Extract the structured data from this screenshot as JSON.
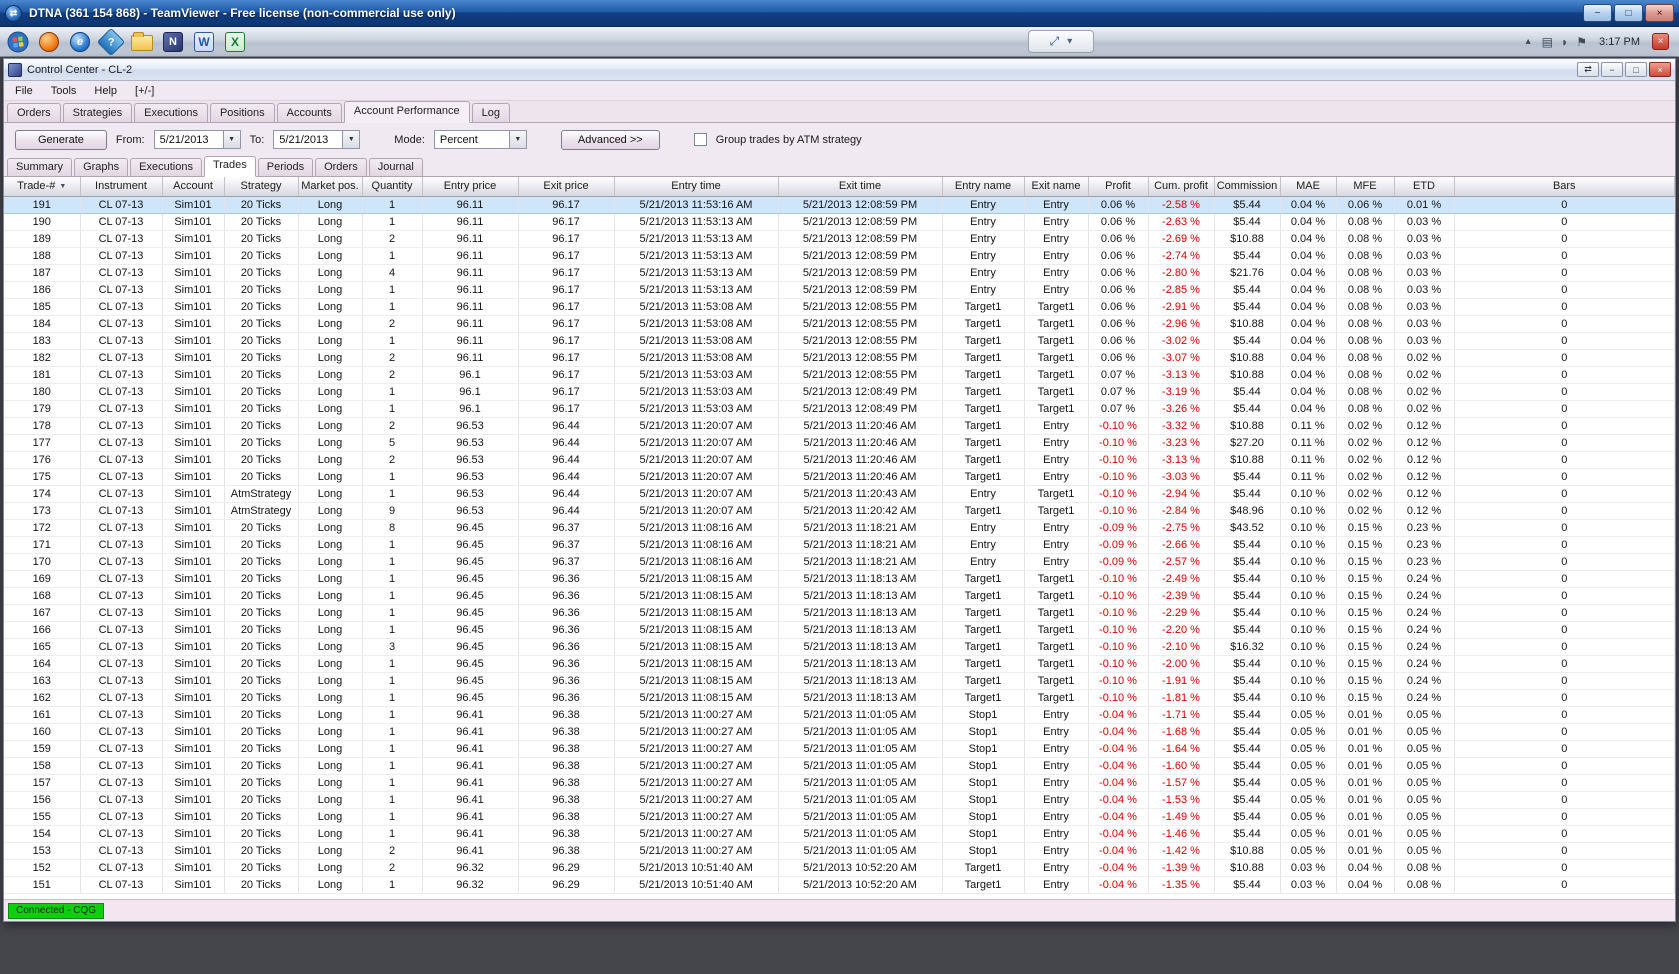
{
  "teamviewer": {
    "title": "DTNA (361 154 868) - TeamViewer - Free license (non-commercial use only)"
  },
  "taskbar": {
    "clock": "3:17 PM"
  },
  "window": {
    "title": "Control Center - CL-2",
    "menus": [
      "File",
      "Tools",
      "Help",
      "[+/-]"
    ]
  },
  "tabs": [
    "Orders",
    "Strategies",
    "Executions",
    "Positions",
    "Accounts",
    "Account Performance",
    "Log"
  ],
  "subtabs": [
    "Summary",
    "Graphs",
    "Executions",
    "Trades",
    "Periods",
    "Orders",
    "Journal"
  ],
  "toolbar": {
    "generate": "Generate",
    "from_label": "From:",
    "from_value": "5/21/2013",
    "to_label": "To:",
    "to_value": "5/21/2013",
    "mode_label": "Mode:",
    "mode_value": "Percent",
    "advanced": "Advanced >>",
    "group_label": "Group trades by ATM strategy",
    "group_checked": false
  },
  "statusbar": {
    "connection": "Connected - CQG"
  },
  "colors": {
    "negative_value": "#d40000",
    "selected_row": "#cfe5fa",
    "status_connected": "#0ecf0e",
    "titlebar_blue": "#215aa6"
  },
  "icons": {
    "minimize": "−",
    "maximize": "□",
    "close": "×",
    "sort_desc": "▼",
    "dropdown_arrow": "▼",
    "chevron_down": "▾",
    "resize": "⤢",
    "hidden_icons": "▴",
    "link": "⇄",
    "help": "?",
    "ie": "e",
    "ninjatrader": "N",
    "word": "W",
    "excel": "X",
    "tray_display": "▤",
    "tray_volume": "◗",
    "tray_flag": "⚑",
    "session_close": "×",
    "tv_logo": "⇄"
  },
  "table": {
    "sort_column": "Trade-#",
    "sort_direction": "desc",
    "selected_row_index": 0,
    "columns": [
      "Trade-#",
      "Instrument",
      "Account",
      "Strategy",
      "Market pos.",
      "Quantity",
      "Entry price",
      "Exit price",
      "Entry time",
      "Exit time",
      "Entry name",
      "Exit name",
      "Profit",
      "Cum. profit",
      "Commission",
      "MAE",
      "MFE",
      "ETD",
      "Bars"
    ],
    "rows": [
      [
        "191",
        "CL 07-13",
        "Sim101",
        "20 Ticks",
        "Long",
        "1",
        "96.11",
        "96.17",
        "5/21/2013 11:53:16 AM",
        "5/21/2013 12:08:59 PM",
        "Entry",
        "Entry",
        "0.06 %",
        "-2.58 %",
        "$5.44",
        "0.04 %",
        "0.06 %",
        "0.01 %",
        "0"
      ],
      [
        "190",
        "CL 07-13",
        "Sim101",
        "20 Ticks",
        "Long",
        "1",
        "96.11",
        "96.17",
        "5/21/2013 11:53:13 AM",
        "5/21/2013 12:08:59 PM",
        "Entry",
        "Entry",
        "0.06 %",
        "-2.63 %",
        "$5.44",
        "0.04 %",
        "0.08 %",
        "0.03 %",
        "0"
      ],
      [
        "189",
        "CL 07-13",
        "Sim101",
        "20 Ticks",
        "Long",
        "2",
        "96.11",
        "96.17",
        "5/21/2013 11:53:13 AM",
        "5/21/2013 12:08:59 PM",
        "Entry",
        "Entry",
        "0.06 %",
        "-2.69 %",
        "$10.88",
        "0.04 %",
        "0.08 %",
        "0.03 %",
        "0"
      ],
      [
        "188",
        "CL 07-13",
        "Sim101",
        "20 Ticks",
        "Long",
        "1",
        "96.11",
        "96.17",
        "5/21/2013 11:53:13 AM",
        "5/21/2013 12:08:59 PM",
        "Entry",
        "Entry",
        "0.06 %",
        "-2.74 %",
        "$5.44",
        "0.04 %",
        "0.08 %",
        "0.03 %",
        "0"
      ],
      [
        "187",
        "CL 07-13",
        "Sim101",
        "20 Ticks",
        "Long",
        "4",
        "96.11",
        "96.17",
        "5/21/2013 11:53:13 AM",
        "5/21/2013 12:08:59 PM",
        "Entry",
        "Entry",
        "0.06 %",
        "-2.80 %",
        "$21.76",
        "0.04 %",
        "0.08 %",
        "0.03 %",
        "0"
      ],
      [
        "186",
        "CL 07-13",
        "Sim101",
        "20 Ticks",
        "Long",
        "1",
        "96.11",
        "96.17",
        "5/21/2013 11:53:13 AM",
        "5/21/2013 12:08:59 PM",
        "Entry",
        "Entry",
        "0.06 %",
        "-2.85 %",
        "$5.44",
        "0.04 %",
        "0.08 %",
        "0.03 %",
        "0"
      ],
      [
        "185",
        "CL 07-13",
        "Sim101",
        "20 Ticks",
        "Long",
        "1",
        "96.11",
        "96.17",
        "5/21/2013 11:53:08 AM",
        "5/21/2013 12:08:55 PM",
        "Target1",
        "Target1",
        "0.06 %",
        "-2.91 %",
        "$5.44",
        "0.04 %",
        "0.08 %",
        "0.03 %",
        "0"
      ],
      [
        "184",
        "CL 07-13",
        "Sim101",
        "20 Ticks",
        "Long",
        "2",
        "96.11",
        "96.17",
        "5/21/2013 11:53:08 AM",
        "5/21/2013 12:08:55 PM",
        "Target1",
        "Target1",
        "0.06 %",
        "-2.96 %",
        "$10.88",
        "0.04 %",
        "0.08 %",
        "0.03 %",
        "0"
      ],
      [
        "183",
        "CL 07-13",
        "Sim101",
        "20 Ticks",
        "Long",
        "1",
        "96.11",
        "96.17",
        "5/21/2013 11:53:08 AM",
        "5/21/2013 12:08:55 PM",
        "Target1",
        "Target1",
        "0.06 %",
        "-3.02 %",
        "$5.44",
        "0.04 %",
        "0.08 %",
        "0.03 %",
        "0"
      ],
      [
        "182",
        "CL 07-13",
        "Sim101",
        "20 Ticks",
        "Long",
        "2",
        "96.11",
        "96.17",
        "5/21/2013 11:53:08 AM",
        "5/21/2013 12:08:55 PM",
        "Target1",
        "Target1",
        "0.06 %",
        "-3.07 %",
        "$10.88",
        "0.04 %",
        "0.08 %",
        "0.02 %",
        "0"
      ],
      [
        "181",
        "CL 07-13",
        "Sim101",
        "20 Ticks",
        "Long",
        "2",
        "96.1",
        "96.17",
        "5/21/2013 11:53:03 AM",
        "5/21/2013 12:08:55 PM",
        "Target1",
        "Target1",
        "0.07 %",
        "-3.13 %",
        "$10.88",
        "0.04 %",
        "0.08 %",
        "0.02 %",
        "0"
      ],
      [
        "180",
        "CL 07-13",
        "Sim101",
        "20 Ticks",
        "Long",
        "1",
        "96.1",
        "96.17",
        "5/21/2013 11:53:03 AM",
        "5/21/2013 12:08:49 PM",
        "Target1",
        "Target1",
        "0.07 %",
        "-3.19 %",
        "$5.44",
        "0.04 %",
        "0.08 %",
        "0.02 %",
        "0"
      ],
      [
        "179",
        "CL 07-13",
        "Sim101",
        "20 Ticks",
        "Long",
        "1",
        "96.1",
        "96.17",
        "5/21/2013 11:53:03 AM",
        "5/21/2013 12:08:49 PM",
        "Target1",
        "Target1",
        "0.07 %",
        "-3.26 %",
        "$5.44",
        "0.04 %",
        "0.08 %",
        "0.02 %",
        "0"
      ],
      [
        "178",
        "CL 07-13",
        "Sim101",
        "20 Ticks",
        "Long",
        "2",
        "96.53",
        "96.44",
        "5/21/2013 11:20:07 AM",
        "5/21/2013 11:20:46 AM",
        "Target1",
        "Entry",
        "-0.10 %",
        "-3.32 %",
        "$10.88",
        "0.11 %",
        "0.02 %",
        "0.12 %",
        "0"
      ],
      [
        "177",
        "CL 07-13",
        "Sim101",
        "20 Ticks",
        "Long",
        "5",
        "96.53",
        "96.44",
        "5/21/2013 11:20:07 AM",
        "5/21/2013 11:20:46 AM",
        "Target1",
        "Entry",
        "-0.10 %",
        "-3.23 %",
        "$27.20",
        "0.11 %",
        "0.02 %",
        "0.12 %",
        "0"
      ],
      [
        "176",
        "CL 07-13",
        "Sim101",
        "20 Ticks",
        "Long",
        "2",
        "96.53",
        "96.44",
        "5/21/2013 11:20:07 AM",
        "5/21/2013 11:20:46 AM",
        "Target1",
        "Entry",
        "-0.10 %",
        "-3.13 %",
        "$10.88",
        "0.11 %",
        "0.02 %",
        "0.12 %",
        "0"
      ],
      [
        "175",
        "CL 07-13",
        "Sim101",
        "20 Ticks",
        "Long",
        "1",
        "96.53",
        "96.44",
        "5/21/2013 11:20:07 AM",
        "5/21/2013 11:20:46 AM",
        "Target1",
        "Entry",
        "-0.10 %",
        "-3.03 %",
        "$5.44",
        "0.11 %",
        "0.02 %",
        "0.12 %",
        "0"
      ],
      [
        "174",
        "CL 07-13",
        "Sim101",
        "AtmStrategy",
        "Long",
        "1",
        "96.53",
        "96.44",
        "5/21/2013 11:20:07 AM",
        "5/21/2013 11:20:43 AM",
        "Entry",
        "Target1",
        "-0.10 %",
        "-2.94 %",
        "$5.44",
        "0.10 %",
        "0.02 %",
        "0.12 %",
        "0"
      ],
      [
        "173",
        "CL 07-13",
        "Sim101",
        "AtmStrategy",
        "Long",
        "9",
        "96.53",
        "96.44",
        "5/21/2013 11:20:07 AM",
        "5/21/2013 11:20:42 AM",
        "Target1",
        "Target1",
        "-0.10 %",
        "-2.84 %",
        "$48.96",
        "0.10 %",
        "0.02 %",
        "0.12 %",
        "0"
      ],
      [
        "172",
        "CL 07-13",
        "Sim101",
        "20 Ticks",
        "Long",
        "8",
        "96.45",
        "96.37",
        "5/21/2013 11:08:16 AM",
        "5/21/2013 11:18:21 AM",
        "Entry",
        "Entry",
        "-0.09 %",
        "-2.75 %",
        "$43.52",
        "0.10 %",
        "0.15 %",
        "0.23 %",
        "0"
      ],
      [
        "171",
        "CL 07-13",
        "Sim101",
        "20 Ticks",
        "Long",
        "1",
        "96.45",
        "96.37",
        "5/21/2013 11:08:16 AM",
        "5/21/2013 11:18:21 AM",
        "Entry",
        "Entry",
        "-0.09 %",
        "-2.66 %",
        "$5.44",
        "0.10 %",
        "0.15 %",
        "0.23 %",
        "0"
      ],
      [
        "170",
        "CL 07-13",
        "Sim101",
        "20 Ticks",
        "Long",
        "1",
        "96.45",
        "96.37",
        "5/21/2013 11:08:16 AM",
        "5/21/2013 11:18:21 AM",
        "Entry",
        "Entry",
        "-0.09 %",
        "-2.57 %",
        "$5.44",
        "0.10 %",
        "0.15 %",
        "0.23 %",
        "0"
      ],
      [
        "169",
        "CL 07-13",
        "Sim101",
        "20 Ticks",
        "Long",
        "1",
        "96.45",
        "96.36",
        "5/21/2013 11:08:15 AM",
        "5/21/2013 11:18:13 AM",
        "Target1",
        "Target1",
        "-0.10 %",
        "-2.49 %",
        "$5.44",
        "0.10 %",
        "0.15 %",
        "0.24 %",
        "0"
      ],
      [
        "168",
        "CL 07-13",
        "Sim101",
        "20 Ticks",
        "Long",
        "1",
        "96.45",
        "96.36",
        "5/21/2013 11:08:15 AM",
        "5/21/2013 11:18:13 AM",
        "Target1",
        "Target1",
        "-0.10 %",
        "-2.39 %",
        "$5.44",
        "0.10 %",
        "0.15 %",
        "0.24 %",
        "0"
      ],
      [
        "167",
        "CL 07-13",
        "Sim101",
        "20 Ticks",
        "Long",
        "1",
        "96.45",
        "96.36",
        "5/21/2013 11:08:15 AM",
        "5/21/2013 11:18:13 AM",
        "Target1",
        "Target1",
        "-0.10 %",
        "-2.29 %",
        "$5.44",
        "0.10 %",
        "0.15 %",
        "0.24 %",
        "0"
      ],
      [
        "166",
        "CL 07-13",
        "Sim101",
        "20 Ticks",
        "Long",
        "1",
        "96.45",
        "96.36",
        "5/21/2013 11:08:15 AM",
        "5/21/2013 11:18:13 AM",
        "Target1",
        "Target1",
        "-0.10 %",
        "-2.20 %",
        "$5.44",
        "0.10 %",
        "0.15 %",
        "0.24 %",
        "0"
      ],
      [
        "165",
        "CL 07-13",
        "Sim101",
        "20 Ticks",
        "Long",
        "3",
        "96.45",
        "96.36",
        "5/21/2013 11:08:15 AM",
        "5/21/2013 11:18:13 AM",
        "Target1",
        "Target1",
        "-0.10 %",
        "-2.10 %",
        "$16.32",
        "0.10 %",
        "0.15 %",
        "0.24 %",
        "0"
      ],
      [
        "164",
        "CL 07-13",
        "Sim101",
        "20 Ticks",
        "Long",
        "1",
        "96.45",
        "96.36",
        "5/21/2013 11:08:15 AM",
        "5/21/2013 11:18:13 AM",
        "Target1",
        "Target1",
        "-0.10 %",
        "-2.00 %",
        "$5.44",
        "0.10 %",
        "0.15 %",
        "0.24 %",
        "0"
      ],
      [
        "163",
        "CL 07-13",
        "Sim101",
        "20 Ticks",
        "Long",
        "1",
        "96.45",
        "96.36",
        "5/21/2013 11:08:15 AM",
        "5/21/2013 11:18:13 AM",
        "Target1",
        "Target1",
        "-0.10 %",
        "-1.91 %",
        "$5.44",
        "0.10 %",
        "0.15 %",
        "0.24 %",
        "0"
      ],
      [
        "162",
        "CL 07-13",
        "Sim101",
        "20 Ticks",
        "Long",
        "1",
        "96.45",
        "96.36",
        "5/21/2013 11:08:15 AM",
        "5/21/2013 11:18:13 AM",
        "Target1",
        "Target1",
        "-0.10 %",
        "-1.81 %",
        "$5.44",
        "0.10 %",
        "0.15 %",
        "0.24 %",
        "0"
      ],
      [
        "161",
        "CL 07-13",
        "Sim101",
        "20 Ticks",
        "Long",
        "1",
        "96.41",
        "96.38",
        "5/21/2013 11:00:27 AM",
        "5/21/2013 11:01:05 AM",
        "Stop1",
        "Entry",
        "-0.04 %",
        "-1.71 %",
        "$5.44",
        "0.05 %",
        "0.01 %",
        "0.05 %",
        "0"
      ],
      [
        "160",
        "CL 07-13",
        "Sim101",
        "20 Ticks",
        "Long",
        "1",
        "96.41",
        "96.38",
        "5/21/2013 11:00:27 AM",
        "5/21/2013 11:01:05 AM",
        "Stop1",
        "Entry",
        "-0.04 %",
        "-1.68 %",
        "$5.44",
        "0.05 %",
        "0.01 %",
        "0.05 %",
        "0"
      ],
      [
        "159",
        "CL 07-13",
        "Sim101",
        "20 Ticks",
        "Long",
        "1",
        "96.41",
        "96.38",
        "5/21/2013 11:00:27 AM",
        "5/21/2013 11:01:05 AM",
        "Stop1",
        "Entry",
        "-0.04 %",
        "-1.64 %",
        "$5.44",
        "0.05 %",
        "0.01 %",
        "0.05 %",
        "0"
      ],
      [
        "158",
        "CL 07-13",
        "Sim101",
        "20 Ticks",
        "Long",
        "1",
        "96.41",
        "96.38",
        "5/21/2013 11:00:27 AM",
        "5/21/2013 11:01:05 AM",
        "Stop1",
        "Entry",
        "-0.04 %",
        "-1.60 %",
        "$5.44",
        "0.05 %",
        "0.01 %",
        "0.05 %",
        "0"
      ],
      [
        "157",
        "CL 07-13",
        "Sim101",
        "20 Ticks",
        "Long",
        "1",
        "96.41",
        "96.38",
        "5/21/2013 11:00:27 AM",
        "5/21/2013 11:01:05 AM",
        "Stop1",
        "Entry",
        "-0.04 %",
        "-1.57 %",
        "$5.44",
        "0.05 %",
        "0.01 %",
        "0.05 %",
        "0"
      ],
      [
        "156",
        "CL 07-13",
        "Sim101",
        "20 Ticks",
        "Long",
        "1",
        "96.41",
        "96.38",
        "5/21/2013 11:00:27 AM",
        "5/21/2013 11:01:05 AM",
        "Stop1",
        "Entry",
        "-0.04 %",
        "-1.53 %",
        "$5.44",
        "0.05 %",
        "0.01 %",
        "0.05 %",
        "0"
      ],
      [
        "155",
        "CL 07-13",
        "Sim101",
        "20 Ticks",
        "Long",
        "1",
        "96.41",
        "96.38",
        "5/21/2013 11:00:27 AM",
        "5/21/2013 11:01:05 AM",
        "Stop1",
        "Entry",
        "-0.04 %",
        "-1.49 %",
        "$5.44",
        "0.05 %",
        "0.01 %",
        "0.05 %",
        "0"
      ],
      [
        "154",
        "CL 07-13",
        "Sim101",
        "20 Ticks",
        "Long",
        "1",
        "96.41",
        "96.38",
        "5/21/2013 11:00:27 AM",
        "5/21/2013 11:01:05 AM",
        "Stop1",
        "Entry",
        "-0.04 %",
        "-1.46 %",
        "$5.44",
        "0.05 %",
        "0.01 %",
        "0.05 %",
        "0"
      ],
      [
        "153",
        "CL 07-13",
        "Sim101",
        "20 Ticks",
        "Long",
        "2",
        "96.41",
        "96.38",
        "5/21/2013 11:00:27 AM",
        "5/21/2013 11:01:05 AM",
        "Stop1",
        "Entry",
        "-0.04 %",
        "-1.42 %",
        "$10.88",
        "0.05 %",
        "0.01 %",
        "0.05 %",
        "0"
      ],
      [
        "152",
        "CL 07-13",
        "Sim101",
        "20 Ticks",
        "Long",
        "2",
        "96.32",
        "96.29",
        "5/21/2013 10:51:40 AM",
        "5/21/2013 10:52:20 AM",
        "Target1",
        "Entry",
        "-0.04 %",
        "-1.39 %",
        "$10.88",
        "0.03 %",
        "0.04 %",
        "0.08 %",
        "0"
      ],
      [
        "151",
        "CL 07-13",
        "Sim101",
        "20 Ticks",
        "Long",
        "1",
        "96.32",
        "96.29",
        "5/21/2013 10:51:40 AM",
        "5/21/2013 10:52:20 AM",
        "Target1",
        "Entry",
        "-0.04 %",
        "-1.35 %",
        "$5.44",
        "0.03 %",
        "0.04 %",
        "0.08 %",
        "0"
      ]
    ]
  }
}
